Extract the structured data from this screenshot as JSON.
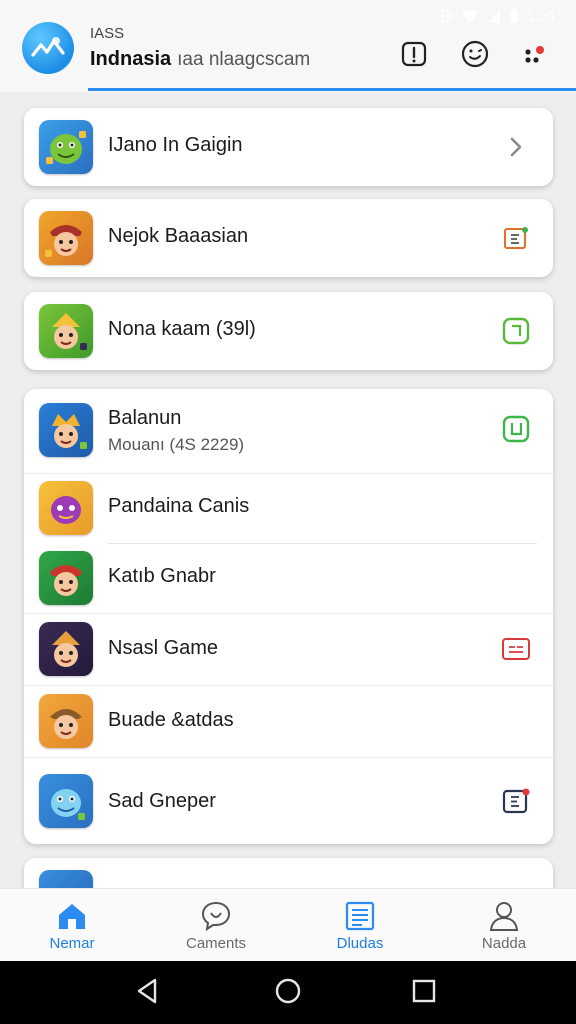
{
  "status_bar": {
    "time": "1:20"
  },
  "header": {
    "small_text": "IASS",
    "title": "Indnasia",
    "subtitle": "ıaa nlaagcscam",
    "accent": "#2a8bf0"
  },
  "list": [
    {
      "label": "IJano In Gaigin",
      "action_icon": "chevron-right-icon",
      "icon_colors": [
        "#3aa0e8",
        "#7cc53a"
      ]
    },
    {
      "label": "Nejok Baaasian",
      "action_icon": "notification-orange-icon",
      "icon_colors": [
        "#f0a62a",
        "#b33a2a"
      ]
    },
    {
      "label": "Nona kaam (39l)",
      "action_icon": "square-green-icon",
      "icon_colors": [
        "#7cc53a",
        "#f3c13a"
      ]
    },
    {
      "label": "Balanun",
      "sub": "Mouanı (4S 2229)",
      "action_icon": "square-green-icon",
      "icon_colors": [
        "#2b7fd8",
        "#f2b22e"
      ]
    },
    {
      "label": "Pandaina Canis",
      "action_icon": "",
      "icon_colors": [
        "#f5c23a",
        "#9d3ab5"
      ]
    },
    {
      "label": "Katıb Gnabr",
      "action_icon": "",
      "icon_colors": [
        "#2fa84a",
        "#c8352b"
      ]
    },
    {
      "label": "Nsasl Game",
      "action_icon": "message-red-icon",
      "icon_colors": [
        "#3a2a55",
        "#e5a03a"
      ]
    },
    {
      "label": "Buade &atdas",
      "action_icon": "",
      "icon_colors": [
        "#f2a83a",
        "#8a5a2a"
      ]
    },
    {
      "label": "Sad Gneper",
      "action_icon": "badge-navy-icon",
      "icon_colors": [
        "#3a8fe0",
        "#84d2f2"
      ]
    }
  ],
  "bottom_nav": [
    {
      "label": "Nemar",
      "icon": "home-icon",
      "active": true
    },
    {
      "label": "Caments",
      "icon": "chat-bubble-icon",
      "active": false
    },
    {
      "label": "Dludas",
      "icon": "news-list-icon",
      "active": true
    },
    {
      "label": "Nadda",
      "icon": "person-icon",
      "active": false
    }
  ]
}
